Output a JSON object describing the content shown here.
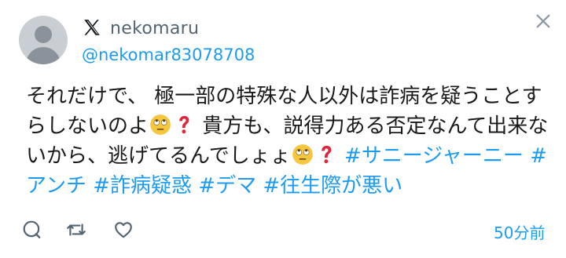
{
  "author": {
    "display_name": "nekomaru",
    "handle": "@nekomar83078708",
    "avatar_icon": "default-avatar-icon"
  },
  "header": {
    "platform_icon": "x-logo-icon",
    "close_icon": "close-icon"
  },
  "tweet": {
    "segments": [
      {
        "type": "text",
        "value": "それだけで、 極一部の特殊な人以外は詐病を疑うことすらしないのよ"
      },
      {
        "type": "emoji",
        "name": "eye-roll-emoji"
      },
      {
        "type": "emoji",
        "name": "red-question-mark-emoji"
      },
      {
        "type": "text",
        "value": " 貴方も、説得力ある否定なんて出来ないから、逃げてるんでしょょ"
      },
      {
        "type": "emoji",
        "name": "eye-roll-emoji"
      },
      {
        "type": "emoji",
        "name": "red-question-mark-emoji"
      },
      {
        "type": "text",
        "value": " "
      },
      {
        "type": "hashtag",
        "value": "#サニージャーニー"
      },
      {
        "type": "text",
        "value": " "
      },
      {
        "type": "hashtag",
        "value": "#アンチ"
      },
      {
        "type": "text",
        "value": " "
      },
      {
        "type": "hashtag",
        "value": "#詐病疑惑"
      },
      {
        "type": "text",
        "value": " "
      },
      {
        "type": "hashtag",
        "value": "#デマ"
      },
      {
        "type": "text",
        "value": " "
      },
      {
        "type": "hashtag",
        "value": "#往生際が悪い"
      }
    ]
  },
  "actions": {
    "reply_icon": "reply-icon",
    "retweet_icon": "retweet-icon",
    "like_icon": "like-icon",
    "timestamp": "50分前"
  },
  "colors": {
    "accent": "#1d9bf0",
    "secondary_text": "#536471",
    "icon_gray": "#536471"
  }
}
